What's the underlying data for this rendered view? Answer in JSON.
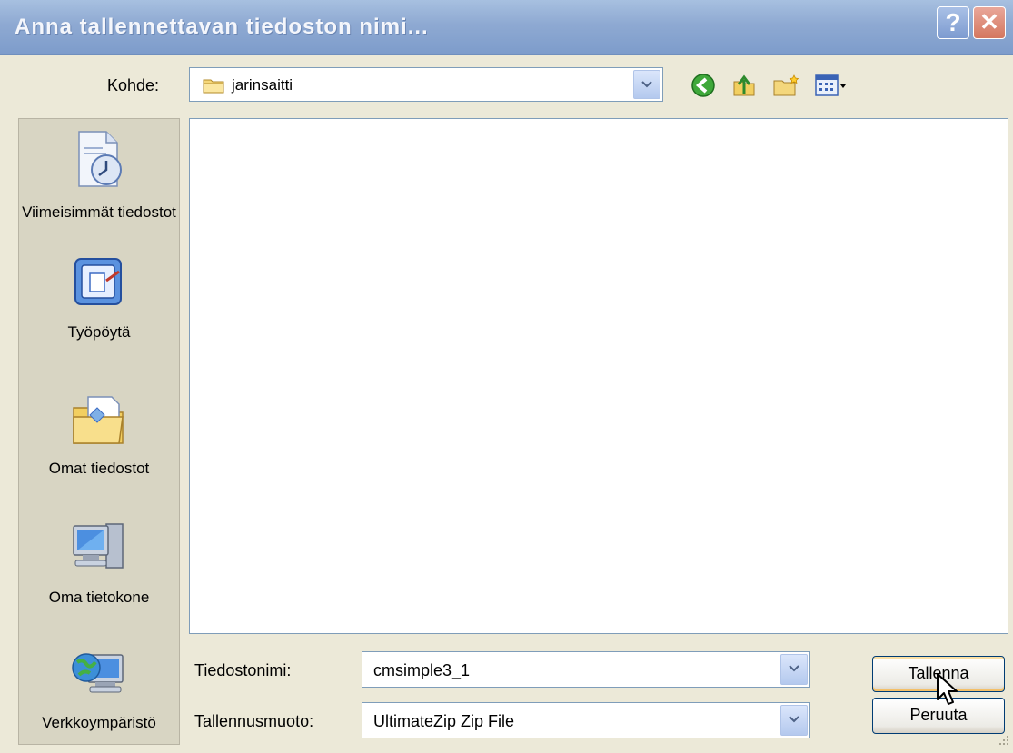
{
  "window": {
    "title": "Anna tallennettavan tiedoston nimi...",
    "help_label": "?",
    "close_label": "✕"
  },
  "address": {
    "label": "Kohde:",
    "folder": "jarinsaitti"
  },
  "toolbar": {
    "icons": [
      "back-icon",
      "up-folder-icon",
      "new-folder-icon",
      "view-menu-icon"
    ]
  },
  "places": [
    {
      "label": "Viimeisimmät tiedostot",
      "icon": "recent-documents-icon"
    },
    {
      "label": "Työpöytä",
      "icon": "desktop-icon"
    },
    {
      "label": "Omat tiedostot",
      "icon": "my-documents-icon"
    },
    {
      "label": "Oma tietokone",
      "icon": "my-computer-icon"
    },
    {
      "label": "Verkkoympäristö",
      "icon": "network-places-icon"
    }
  ],
  "form": {
    "filename_label": "Tiedostonimi:",
    "filename_value": "cmsimple3_1",
    "filetype_label": "Tallennusmuoto:",
    "filetype_value": "UltimateZip Zip File"
  },
  "buttons": {
    "save": "Tallenna",
    "cancel": "Peruuta"
  },
  "colors": {
    "titlebar": "#8ea9d2",
    "dialog_bg": "#ECE9D8",
    "close": "#d4775f"
  }
}
